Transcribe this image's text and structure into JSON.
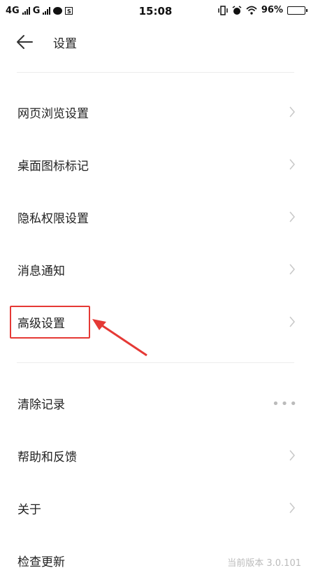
{
  "status_bar": {
    "network1": "4G",
    "network2": "G",
    "time": "15:08",
    "battery": "96%",
    "battery_level": 0.96
  },
  "header": {
    "title": "设置"
  },
  "menu": {
    "items": [
      {
        "label": "网页浏览设置"
      },
      {
        "label": "桌面图标标记"
      },
      {
        "label": "隐私权限设置"
      },
      {
        "label": "消息通知"
      },
      {
        "label": "高级设置"
      },
      {
        "label": "清除记录"
      },
      {
        "label": "帮助和反馈"
      },
      {
        "label": "关于"
      },
      {
        "label": "检查更新",
        "value": "当前版本 3.0.101"
      }
    ]
  },
  "icons": {
    "back": "arrow-left-icon",
    "chevron": "chevron-right-icon",
    "more": "more-dots-icon"
  },
  "colors": {
    "highlight": "#e53935",
    "chevron": "#c8c8c8"
  }
}
